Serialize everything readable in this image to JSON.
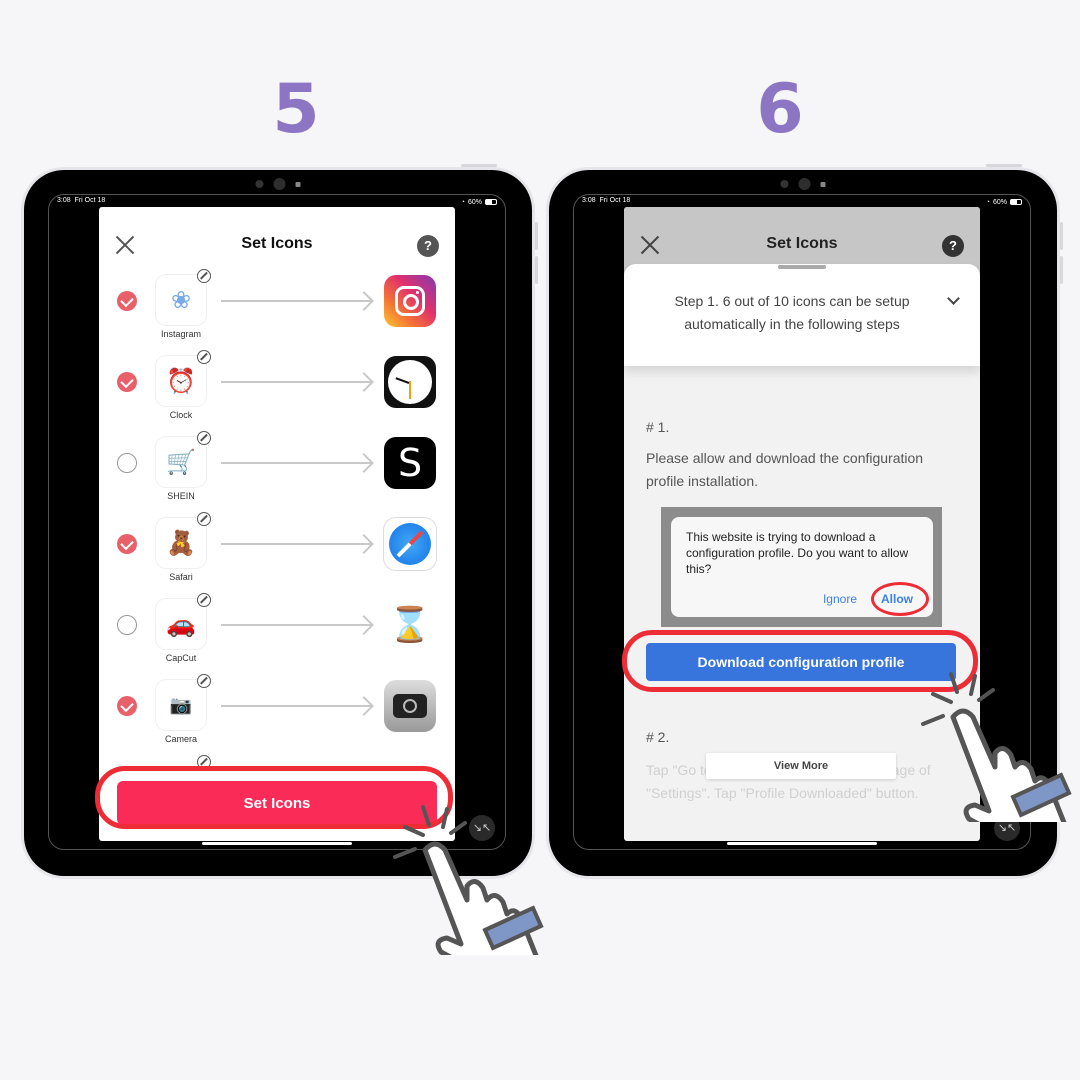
{
  "panels": [
    {
      "step_number": "5",
      "status": {
        "time": "3:08",
        "date": "Fri Oct 18",
        "battery": "60%"
      },
      "app": {
        "title": "Set Icons",
        "close_icon": "close-icon",
        "help_label": "?",
        "rows": [
          {
            "label": "Instagram",
            "checked": true,
            "thumb": "❀",
            "target": "instagram"
          },
          {
            "label": "Clock",
            "checked": true,
            "thumb": "⏰",
            "target": "clock"
          },
          {
            "label": "SHEIN",
            "checked": false,
            "thumb": "🛒",
            "target": "shein",
            "target_text": "S"
          },
          {
            "label": "Safari",
            "checked": true,
            "thumb": "🧸",
            "target": "safari"
          },
          {
            "label": "CapCut",
            "checked": false,
            "thumb": "🚗",
            "target": "capcut",
            "target_text": "⌛"
          },
          {
            "label": "Camera",
            "checked": true,
            "thumb": "📷",
            "target": "camera"
          }
        ],
        "set_button": "Set Icons",
        "shrink_icon": "↘↖"
      }
    },
    {
      "step_number": "6",
      "status": {
        "time": "3:08",
        "date": "Fri Oct 18",
        "battery": "60%"
      },
      "app": {
        "title": "Set Icons",
        "help_label": "?",
        "sheet_text": "Step 1. 6 out of 10 icons can be setup automatically in the following steps",
        "section1_head": "# 1.",
        "section1_body": "Please allow and download the configuration profile installation.",
        "alert_text": "This website is trying to download a configuration profile. Do you want to allow this?",
        "alert_ignore": "Ignore",
        "alert_allow": "Allow",
        "download_button": "Download configuration profile",
        "section2_head": "# 2.",
        "section2_body": "Tap \"Go to Settings\" and go to the top page of \"Settings\". Tap \"Profile Downloaded\" button.",
        "view_more": "View More",
        "shrink_icon": "↘↖"
      }
    }
  ],
  "colors": {
    "step_number": "#8c76c4",
    "set_button": "#fa2c57",
    "download_button": "#3775dd",
    "highlight_ring": "#ee2c36",
    "check_on": "#e8606a"
  }
}
